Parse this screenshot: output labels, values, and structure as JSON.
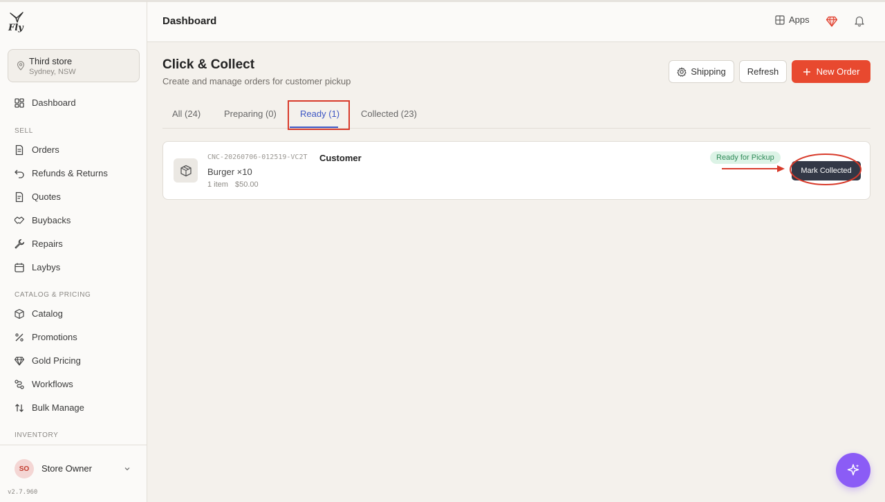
{
  "brand": {
    "logo_text": "Fly"
  },
  "store": {
    "name": "Third store",
    "location": "Sydney, NSW"
  },
  "sidebar": {
    "dashboard": "Dashboard",
    "sections": {
      "sell": "SELL",
      "catalog": "CATALOG & PRICING",
      "inventory": "INVENTORY"
    },
    "sell_items": [
      "Orders",
      "Refunds & Returns",
      "Quotes",
      "Buybacks",
      "Repairs",
      "Laybys"
    ],
    "catalog_items": [
      "Catalog",
      "Promotions",
      "Gold Pricing",
      "Workflows",
      "Bulk Manage"
    ]
  },
  "user": {
    "initials": "SO",
    "name": "Store Owner"
  },
  "version": "v2.7.960",
  "header": {
    "title": "Dashboard",
    "apps_label": "Apps"
  },
  "page": {
    "title": "Click & Collect",
    "subtitle": "Create and manage orders for customer pickup",
    "shipping_label": "Shipping",
    "refresh_label": "Refresh",
    "new_order_label": "New Order"
  },
  "tabs": [
    {
      "label": "All (24)"
    },
    {
      "label": "Preparing (0)"
    },
    {
      "label": "Ready (1)"
    },
    {
      "label": "Collected (23)"
    }
  ],
  "order": {
    "id": "CNC-20260706-012519-VC2T",
    "customer": "Customer",
    "items": "Burger ×10",
    "count": "1 item",
    "total": "$50.00",
    "status": "Ready for Pickup",
    "action_label": "Mark Collected"
  },
  "colors": {
    "accent": "#e8492f",
    "tab_active": "#3d56c4",
    "status_green": "#2f8a58",
    "fab": "#8b5cf6"
  }
}
